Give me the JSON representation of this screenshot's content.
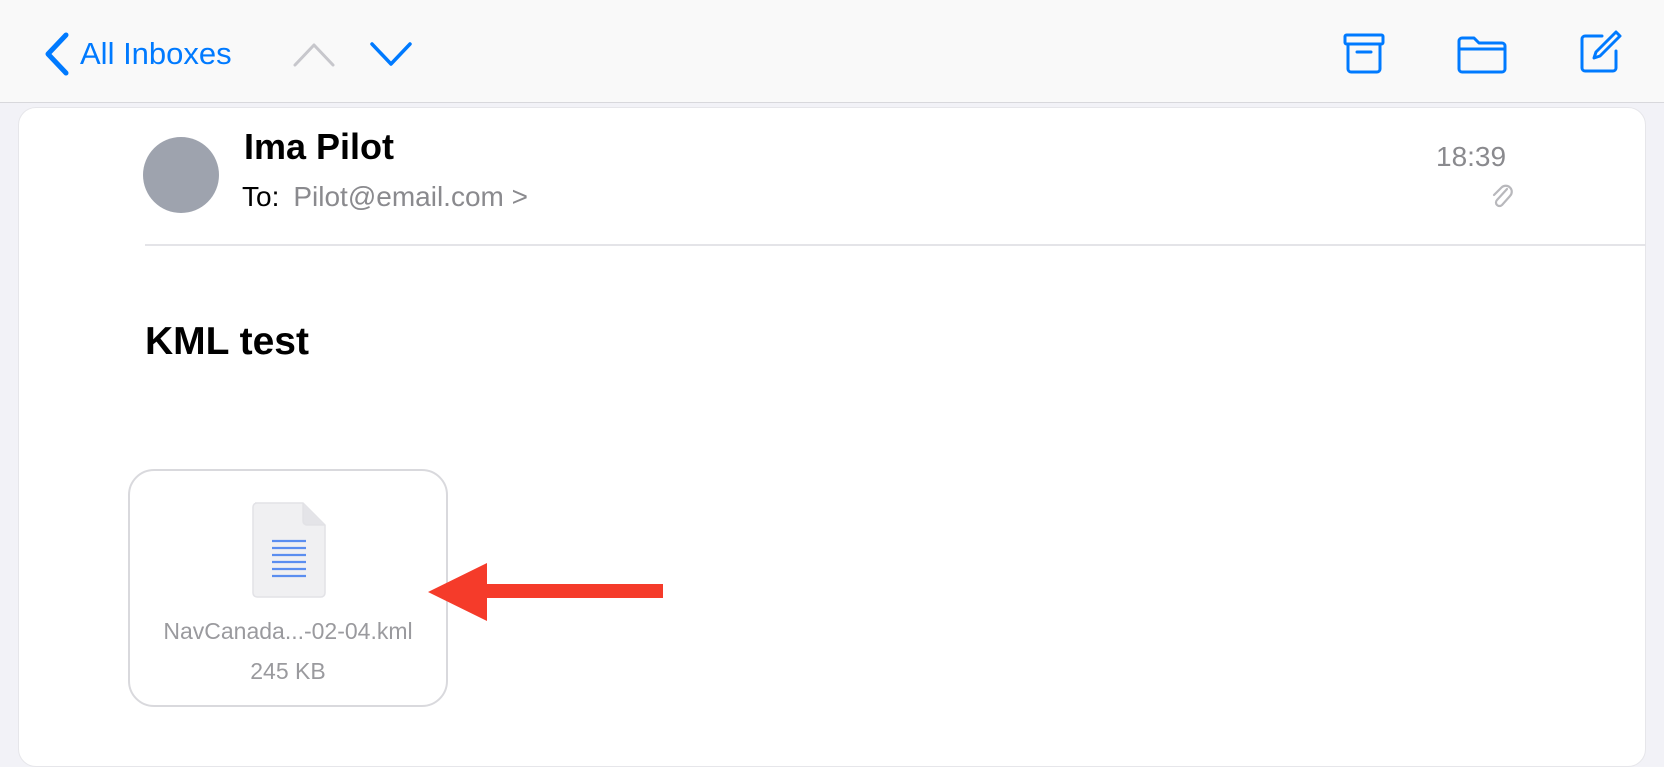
{
  "navbar": {
    "back_label": "All Inboxes",
    "icons": [
      "chevron-up-icon",
      "chevron-down-icon",
      "archive-icon",
      "folder-icon",
      "compose-icon"
    ]
  },
  "message": {
    "sender": "Ima Pilot",
    "to_label": "To:",
    "to_value": "Pilot@email.com >",
    "time": "18:39",
    "subject": "KML test",
    "attachment": {
      "name": "NavCanada...-02-04.kml",
      "size": "245 KB"
    }
  },
  "colors": {
    "accent": "#007aff",
    "annotation_arrow": "#f53b2a",
    "avatar": "#9ea3ae",
    "secondary_text": "#8a8a8e"
  }
}
